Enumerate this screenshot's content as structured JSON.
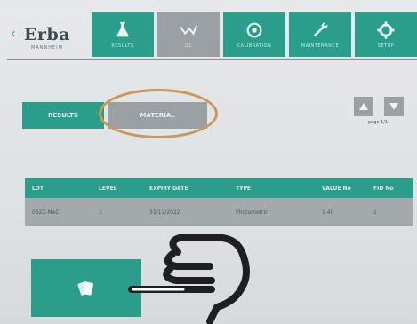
{
  "brand": {
    "name": "Erba",
    "subtitle": "MANNHEIM"
  },
  "nav": {
    "tabs": [
      {
        "label": "RESULTS",
        "icon": "flask-icon",
        "active": false
      },
      {
        "label": "QC",
        "icon": "qc-graph-icon",
        "active": true
      },
      {
        "label": "CALIBRATION",
        "icon": "calibration-icon",
        "active": false
      },
      {
        "label": "MAINTENANCE",
        "icon": "wrench-icon",
        "active": false
      },
      {
        "label": "SETUP",
        "icon": "gear-icon",
        "active": false
      }
    ]
  },
  "toolbar": {
    "results_label": "RESULTS",
    "material_label": "MATERIAL"
  },
  "pager": {
    "label": "page 1/1"
  },
  "table": {
    "headers": [
      "LOT",
      "LEVEL",
      "EXPIRY DATE",
      "TYPE",
      "VALUE No",
      "FID No"
    ],
    "rows": [
      [
        "0622-MeC",
        "1",
        "31/12/2022",
        "Photometric",
        "1.40",
        "1"
      ]
    ]
  },
  "colors": {
    "accent": "#2a9d8b",
    "inactive": "#9aa0a3",
    "highlight": "#c99a55"
  }
}
